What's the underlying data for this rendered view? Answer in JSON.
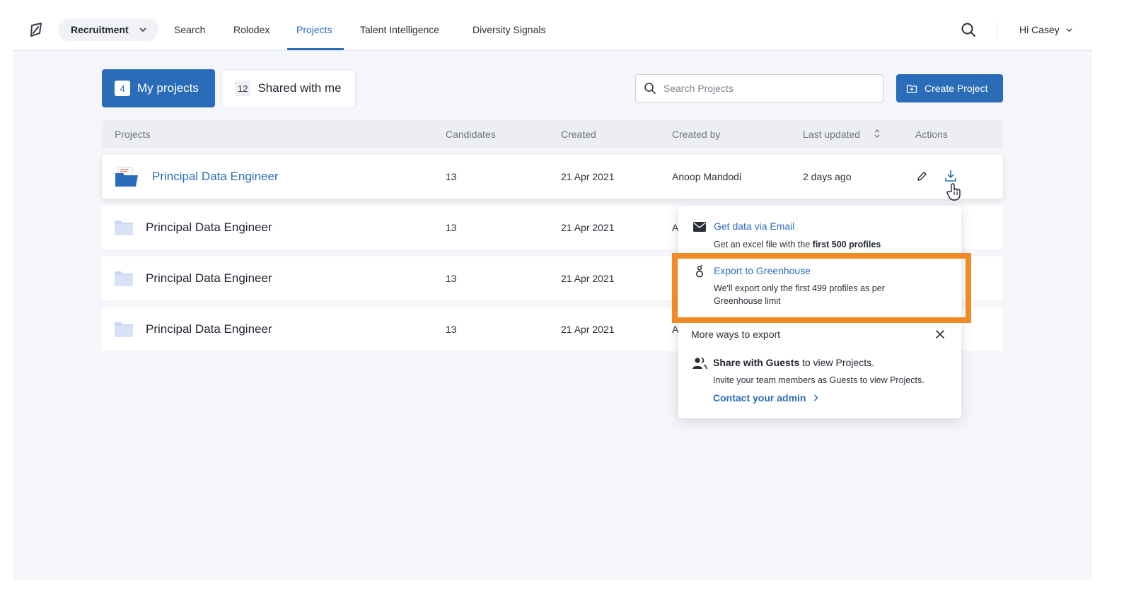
{
  "nav": {
    "workspace": "Recruitment",
    "items": [
      {
        "label": "Search",
        "active": false
      },
      {
        "label": "Rolodex",
        "active": false
      },
      {
        "label": "Projects",
        "active": true
      },
      {
        "label": "Talent Intelligence",
        "active": false
      },
      {
        "label": "Diversity Signals",
        "active": false
      }
    ],
    "user_greeting": "Hi Casey"
  },
  "tabs": [
    {
      "count": "4",
      "label": "My projects",
      "active": true
    },
    {
      "count": "12",
      "label": "Shared with me",
      "active": false
    }
  ],
  "search": {
    "placeholder": "Search Projects",
    "value": ""
  },
  "create_button": {
    "label": "Create Project"
  },
  "table": {
    "columns": [
      "Projects",
      "Candidates",
      "Created",
      "Created by",
      "Last updated",
      "Actions"
    ],
    "rows": [
      {
        "name": "Principal Data Engineer",
        "candidates": "13",
        "created": "21 Apr 2021",
        "created_by": "Anoop Mandodi",
        "last_updated": "2 days ago"
      },
      {
        "name": "Principal Data Engineer",
        "candidates": "13",
        "created": "21 Apr 2021",
        "created_by": "A",
        "last_updated": ""
      },
      {
        "name": "Principal Data Engineer",
        "candidates": "13",
        "created": "21 Apr 2021",
        "created_by": "",
        "last_updated": ""
      },
      {
        "name": "Principal Data Engineer",
        "candidates": "13",
        "created": "21 Apr 2021",
        "created_by": "A",
        "last_updated": ""
      }
    ]
  },
  "export_menu": {
    "email": {
      "title": "Get data via Email",
      "desc_prefix": "Get an excel file with the ",
      "desc_bold": "first 500 profiles"
    },
    "greenhouse": {
      "title": "Export to Greenhouse",
      "desc": "We'll export only the first 499 profiles as per Greenhouse limit"
    },
    "more_ways": "More ways to export",
    "share": {
      "title_bold": "Share with Guests",
      "title_rest": " to view Projects.",
      "desc": "Invite your team members as Guests to view Projects.",
      "link": "Contact your admin"
    }
  },
  "colors": {
    "accent": "#2b6cb8",
    "highlight": "#f08a26",
    "folder_light": "#c9d9f2"
  }
}
